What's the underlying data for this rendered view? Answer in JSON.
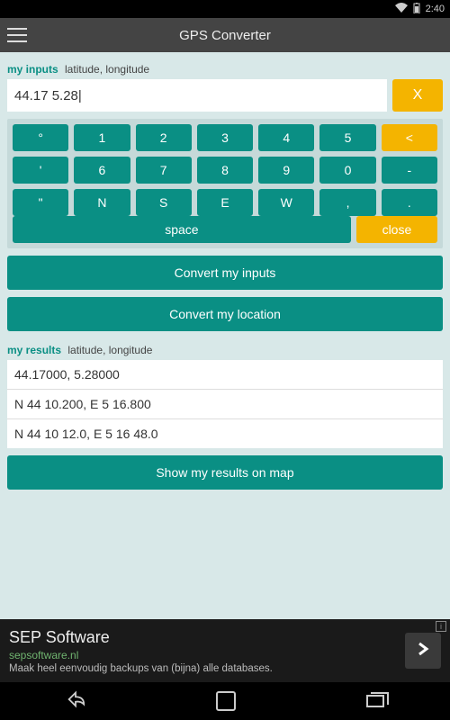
{
  "status": {
    "time": "2:40"
  },
  "app": {
    "title": "GPS Converter"
  },
  "input_section": {
    "label_primary": "my inputs",
    "label_secondary": "latitude, longitude",
    "value": "44.17 5.28|",
    "clear_label": "X"
  },
  "keypad": {
    "rows": [
      [
        {
          "label": "°",
          "style": "teal"
        },
        {
          "label": "1",
          "style": "teal"
        },
        {
          "label": "2",
          "style": "teal"
        },
        {
          "label": "3",
          "style": "teal"
        },
        {
          "label": "4",
          "style": "teal"
        },
        {
          "label": "5",
          "style": "teal"
        },
        {
          "label": "<",
          "style": "yellow"
        }
      ],
      [
        {
          "label": "'",
          "style": "teal"
        },
        {
          "label": "6",
          "style": "teal"
        },
        {
          "label": "7",
          "style": "teal"
        },
        {
          "label": "8",
          "style": "teal"
        },
        {
          "label": "9",
          "style": "teal"
        },
        {
          "label": "0",
          "style": "teal"
        },
        {
          "label": "-",
          "style": "teal"
        }
      ],
      [
        {
          "label": "\"",
          "style": "teal"
        },
        {
          "label": "N",
          "style": "teal"
        },
        {
          "label": "S",
          "style": "teal"
        },
        {
          "label": "E",
          "style": "teal"
        },
        {
          "label": "W",
          "style": "teal"
        },
        {
          "label": ",",
          "style": "teal"
        },
        {
          "label": ".",
          "style": "teal"
        }
      ]
    ],
    "space_label": "space",
    "close_label": "close"
  },
  "actions": {
    "convert_inputs": "Convert my inputs",
    "convert_location": "Convert my location",
    "show_map": "Show my results on map"
  },
  "results_section": {
    "label_primary": "my results",
    "label_secondary": "latitude, longitude",
    "lines": [
      "44.17000, 5.28000",
      "N 44 10.200, E 5 16.800",
      "N 44 10 12.0, E 5 16 48.0"
    ]
  },
  "ad": {
    "title": "SEP Software",
    "link": "sepsoftware.nl",
    "subtitle": "Maak heel eenvoudig backups van (bijna) alle databases."
  }
}
